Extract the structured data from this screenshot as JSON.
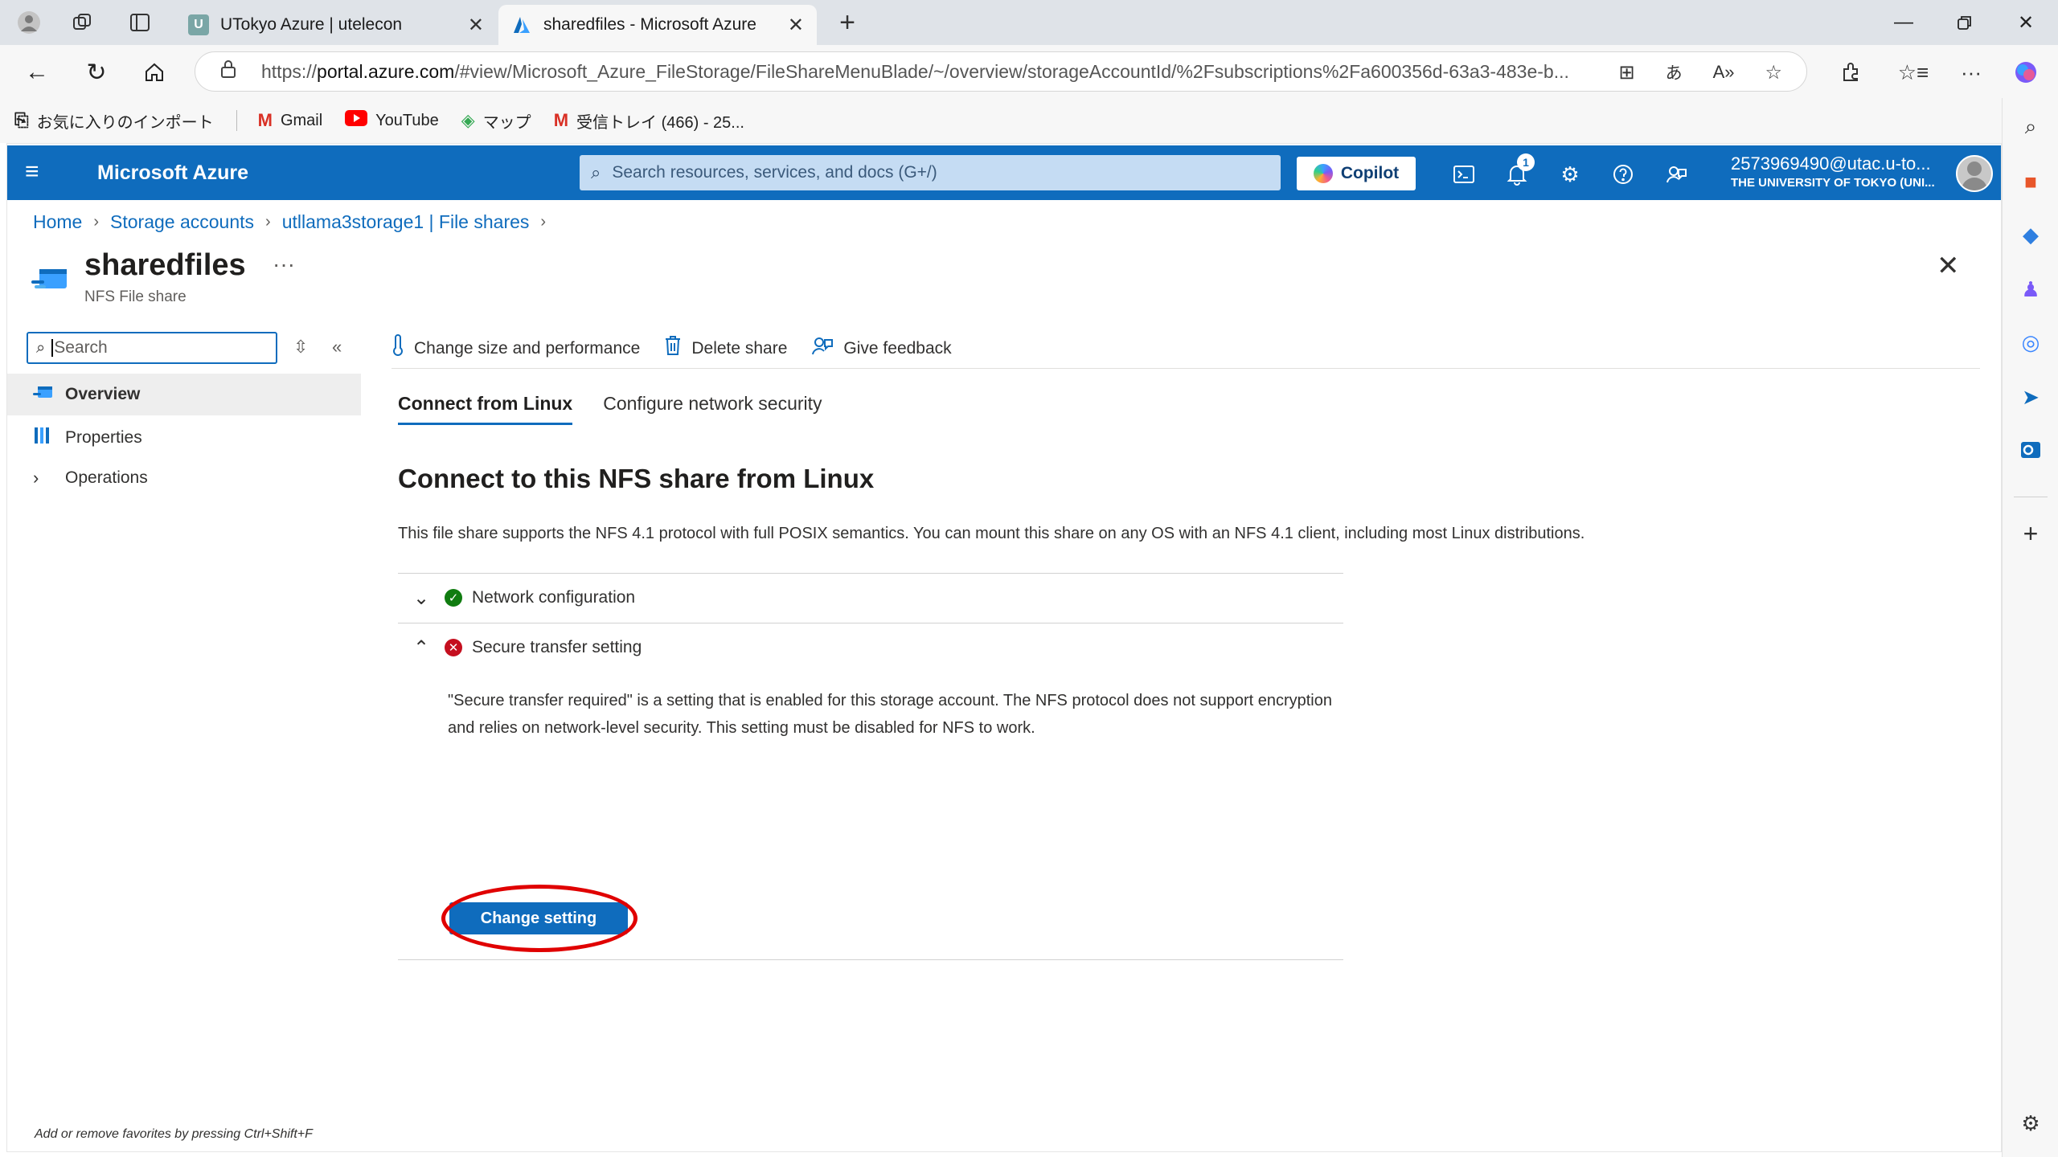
{
  "browser": {
    "tabs": [
      {
        "title": "UTokyo Azure | utelecon",
        "favicon_letter": "U",
        "favicon_color": "#7aa6a6",
        "active": false
      },
      {
        "title": "sharedfiles - Microsoft Azure",
        "favicon_letter": "A",
        "favicon_color": "#0f6cbd",
        "active": true
      }
    ],
    "url_prefix": "https://",
    "url_host": "portal.azure.com",
    "url_path": "/#view/Microsoft_Azure_FileStorage/FileShareMenuBlade/~/overview/storageAccountId/%2Fsubscriptions%2Fa600356d-63a3-483e-b...",
    "favorites": [
      {
        "label": "お気に入りのインポート",
        "icon": "import-icon"
      },
      {
        "label": "Gmail",
        "icon": "gmail-icon"
      },
      {
        "label": "YouTube",
        "icon": "youtube-icon"
      },
      {
        "label": "マップ",
        "icon": "maps-icon"
      },
      {
        "label": "受信トレイ (466) - 25...",
        "icon": "gmail-icon"
      }
    ]
  },
  "portal": {
    "brand": "Microsoft Azure",
    "search_placeholder": "Search resources, services, and docs (G+/)",
    "copilot_label": "Copilot",
    "notification_count": "1",
    "account_email": "2573969490@utac.u-to...",
    "account_org": "THE UNIVERSITY OF TOKYO (UNI..."
  },
  "breadcrumb": [
    "Home",
    "Storage accounts",
    "utllama3storage1 | File shares"
  ],
  "resource": {
    "title": "sharedfiles",
    "subtitle": "NFS File share",
    "more": "···"
  },
  "left_menu": {
    "search_placeholder": "Search",
    "items": [
      {
        "label": "Overview",
        "selected": true
      },
      {
        "label": "Properties",
        "selected": false
      },
      {
        "label": "Operations",
        "selected": false
      }
    ],
    "favorites_hint": "Add or remove favorites by pressing Ctrl+Shift+F"
  },
  "commands": [
    {
      "label": "Change size and performance",
      "icon": "thermometer-icon"
    },
    {
      "label": "Delete share",
      "icon": "trash-icon"
    },
    {
      "label": "Give feedback",
      "icon": "feedback-icon"
    }
  ],
  "content_tabs": [
    {
      "label": "Connect from Linux",
      "active": true
    },
    {
      "label": "Configure network security",
      "active": false
    }
  ],
  "main": {
    "heading": "Connect to this NFS share from Linux",
    "description": "This file share supports the NFS 4.1 protocol with full POSIX semantics. You can mount this share on any OS with an NFS 4.1 client, including most Linux distributions.",
    "sections": [
      {
        "label": "Network configuration",
        "status": "ok",
        "expanded": false
      },
      {
        "label": "Secure transfer setting",
        "status": "error",
        "expanded": true
      }
    ],
    "secure_transfer_text": "\"Secure transfer required\" is a setting that is enabled for this storage account. The NFS protocol does not support encryption and relies on network-level security. This setting must be disabled for NFS to work.",
    "change_setting_label": "Change setting"
  },
  "colors": {
    "azure_blue": "#0f6cbd",
    "success": "#107c10",
    "error": "#c50f1f",
    "annotation_red": "#e00000"
  }
}
